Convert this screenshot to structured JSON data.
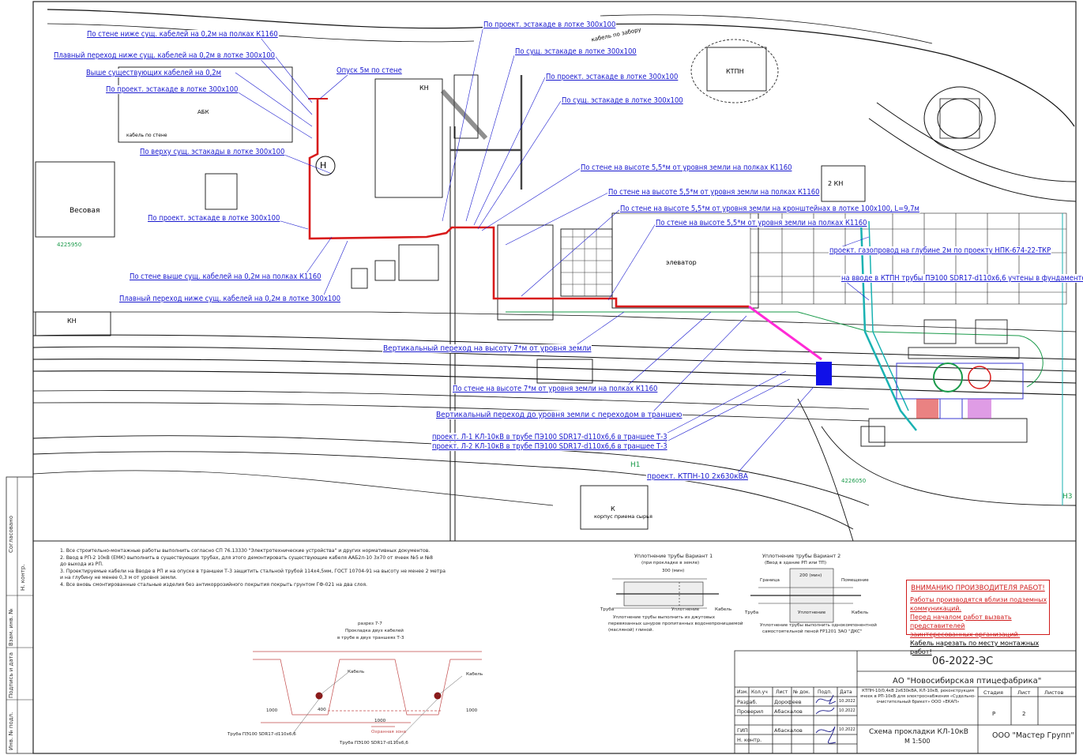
{
  "callouts": [
    "По стене ниже сущ. кабелей на 0,2м на полках К1160",
    "Плавный переход ниже сущ. кабелей на 0,2м в лотке 300х100",
    "Выше существующих кабелей на 0,2м",
    "По проект. эстакаде в лотке 300х100",
    "Опуск 5м по стене",
    "По верху сущ. эстакады в лотке 300х100",
    "По проект. эстакаде в лотке 300х100",
    "По стене выше сущ. кабелей на 0,2м на полках К1160",
    "Плавный переход ниже сущ. кабелей на 0,2м в лотке 300х100",
    "По проект. эстакаде в лотке 300х100",
    "По сущ. эстакаде в лотке 300х100",
    "По проект. эстакаде в лотке 300х100",
    "По сущ. эстакаде в лотке 300х100",
    "По стене на высоте 5,5*м от уровня земли на полках К1160",
    "По стене на высоте 5,5*м от уровня земли на полках К1160",
    "По стене на высоте 5,5*м от уровня земли на кронштейнах в лотке 100х100, L=9,7м",
    "По стене на высоте 5,5*м от уровня земли на полках К1160",
    "проект. газопровод на глубине 2м по проекту НПК-674-22-ТКР",
    "на вводе в КТПН трубы ПЭ100 SDR17-d110х6,6 учтены в фундаменте",
    "Вертикальный переход на высоту 7*м от уровня земли",
    "По стене на высоте 7*м от уровня земли на полках К1160",
    "Вертикальный переход до уровня земли с переходом в траншею",
    "проект. Л-1 КЛ-10кВ в трубе ПЭ100 SDR17-d110х6,6 в траншее Т-3",
    "проект. Л-2 КЛ-10кВ в трубе ПЭ100 SDR17-d110х6,6 в траншее Т-3",
    "проект. КТПН-10 2х630кВА"
  ],
  "buildings": {
    "abk": "АБК",
    "kh1": "КН",
    "kh2": "КН",
    "kh3": "КН",
    "ktpn": "КТПН",
    "elevator": "элеватор",
    "korpus": "корпус приема сырья",
    "vesovaya": "Весовая",
    "two_kn": "2 КН",
    "k": "К",
    "n": "Н",
    "fence_label": "кабель по забору",
    "wall_label": "кабель по стене",
    "coord1": "4225950",
    "coord2": "4226050",
    "n1": "Н1",
    "n3": "Н3"
  },
  "notes": [
    "1. Все строительно-монтажные работы выполнить согласно СП 76.13330 \"Электротехнические устройства\" и других нормативных документов.",
    "2. Ввод в РП-2 10кВ (ЕМК) выполнить в существующих трубах, для этого демонтировать существующие кабеля ААБ2л-10 3х70 от ячеек №5 и №8",
    "до выхода из РП.",
    "3. Проектируемые кабели на Вводе в РП и на опуске в траншеи Т-3 защитить стальной трубой 114х4,5мм, ГОСТ 10704-91 на высоту не менее 2 метра",
    "и на глубину не менее 0,3 м от уровня земли.",
    "4. Все вновь смонтированные стальные изделия без антикоррозийного покрытия покрыть грунтом ГФ-021 на два слоя."
  ],
  "section": {
    "title1": "разрез 7-7",
    "title2": "Прокладка двух кабелей",
    "title3": "в трубе в двух траншеях Т-3",
    "pipe1": "Труба ПЭ100 SDR17-d110х6,6",
    "pipe2": "Труба ПЭ100 SDR17-d110х6,6",
    "cable1": "Кабель",
    "cable2": "Кабель",
    "zone": "Охранная зона",
    "dim_total": "1000",
    "dim_400": "400",
    "dim_300a": "1000",
    "dim_300b": "1000"
  },
  "seal1": {
    "title": "Уплотнение трубы Вариант 1",
    "sub": "(при прокладке в земле)",
    "dim": "300 (мин)",
    "pipe": "Труба",
    "seal": "Уплотнение",
    "cable": "Кабель",
    "note1": "Уплотнение трубы выполнить из джутовых",
    "note2": "перевязанных шнуров пропитанных водонепроницаемой",
    "note3": "(масляной) глиной."
  },
  "seal2": {
    "title": "Уплотнение трубы Вариант 2",
    "sub": "(Ввод в здание РП или ТП)",
    "dim": "200 (мин)",
    "wall": "Граница",
    "room": "Помещение",
    "pipe": "Труба",
    "seal": "Уплотнение",
    "cable": "Кабель",
    "note1": "Уплотнение трубы выполнить однокомпонентной",
    "note2": "самостоятельной пеной FP1201 ЗАО \"ДКС\""
  },
  "warning": {
    "title": "ВНИМАНИЮ ПРОИЗВОДИТЕЛЯ РАБОТ!",
    "lines": [
      "Работы производятся вблизи подземных коммуникаций.",
      "Перед началом работ вызвать представителей",
      "заинтересованных организаций."
    ],
    "cable_note": "Кабель нарезать по месту монтажных работ!"
  },
  "title_block": {
    "doc_code": "06-2022-ЭС",
    "customer": "АО \"Новосибирская птицефабрика\"",
    "project": "КТПН-10/0,4кВ 2х630кВА, КЛ-10кВ, реконструкция ячеек в РП-10кВ для электроснабжения «Судельно-очистительный брикет» ООО «ЕКАП»",
    "head": [
      "Изм.",
      "Кол.уч",
      "Лист",
      "№ док.",
      "Подп.",
      "Дата"
    ],
    "rows": [
      {
        "role": "Разраб.",
        "name": "Дорофеев",
        "date": "10.2022"
      },
      {
        "role": "Проверил",
        "name": "Абаскалов",
        "date": "10.2022"
      },
      {
        "role": "",
        "name": "",
        "date": ""
      },
      {
        "role": "ГИП",
        "name": "Абаскалов",
        "date": "10.2022"
      },
      {
        "role": "Н. контр.",
        "name": "",
        "date": ""
      }
    ],
    "stage_head": [
      "Стадия",
      "Лист",
      "Листов"
    ],
    "stage": "Р",
    "sheet": "2",
    "sheets": "",
    "drawing": "Схема прокладки КЛ-10кВ",
    "scale": "М 1:500",
    "company": "ООО \"Мастер Групп\""
  },
  "side": {
    "agreed": "Согласовано",
    "n_contr": "Н. контр.",
    "inv_zam": "Взам. инв. №",
    "sign_date": "Подпись и дата",
    "inv_podl": "Инв. № подл."
  },
  "colors": {
    "route": "#d81b1b",
    "callout": "#1a1acf",
    "gas": "#19b2b2",
    "magenta": "#ff2bd6",
    "ktpn_block": "#1010e8"
  }
}
